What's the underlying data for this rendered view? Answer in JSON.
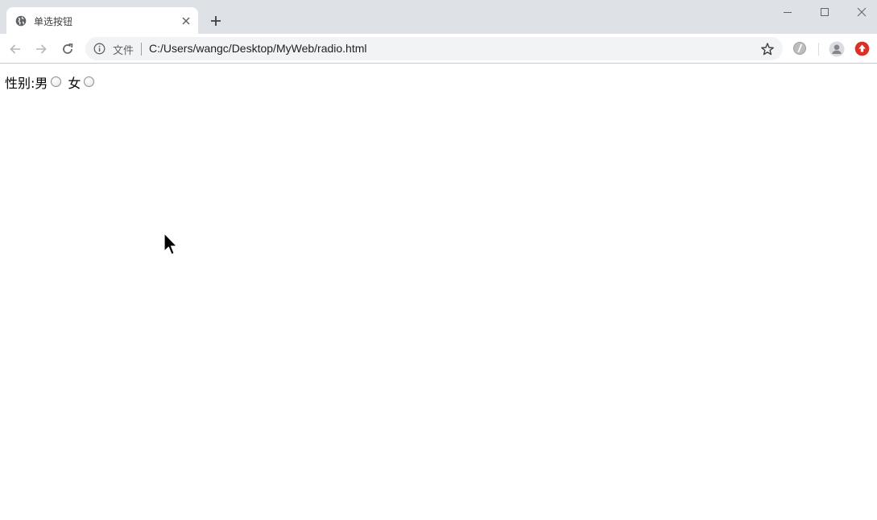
{
  "tab": {
    "title": "单选按钮"
  },
  "address_bar": {
    "security_chip": "文件",
    "url": "C:/Users/wangc/Desktop/MyWeb/radio.html"
  },
  "page": {
    "field_label": "性别:",
    "options": [
      {
        "label": "男",
        "checked": false
      },
      {
        "label": "女",
        "checked": false
      }
    ]
  },
  "icons": {
    "favicon": "globe-icon",
    "tab_close": "close-icon",
    "new_tab": "plus-icon",
    "back": "arrow-left-icon",
    "forward": "arrow-right-icon",
    "reload": "reload-icon",
    "info": "info-icon",
    "bookmark": "star-icon",
    "extension_1": "extension-icon",
    "profile": "avatar-icon",
    "extension_2": "red-extension-icon"
  },
  "colors": {
    "tabstrip": "#dee1e6",
    "omnibox": "#f1f3f4",
    "ext2_red": "#d93025"
  }
}
